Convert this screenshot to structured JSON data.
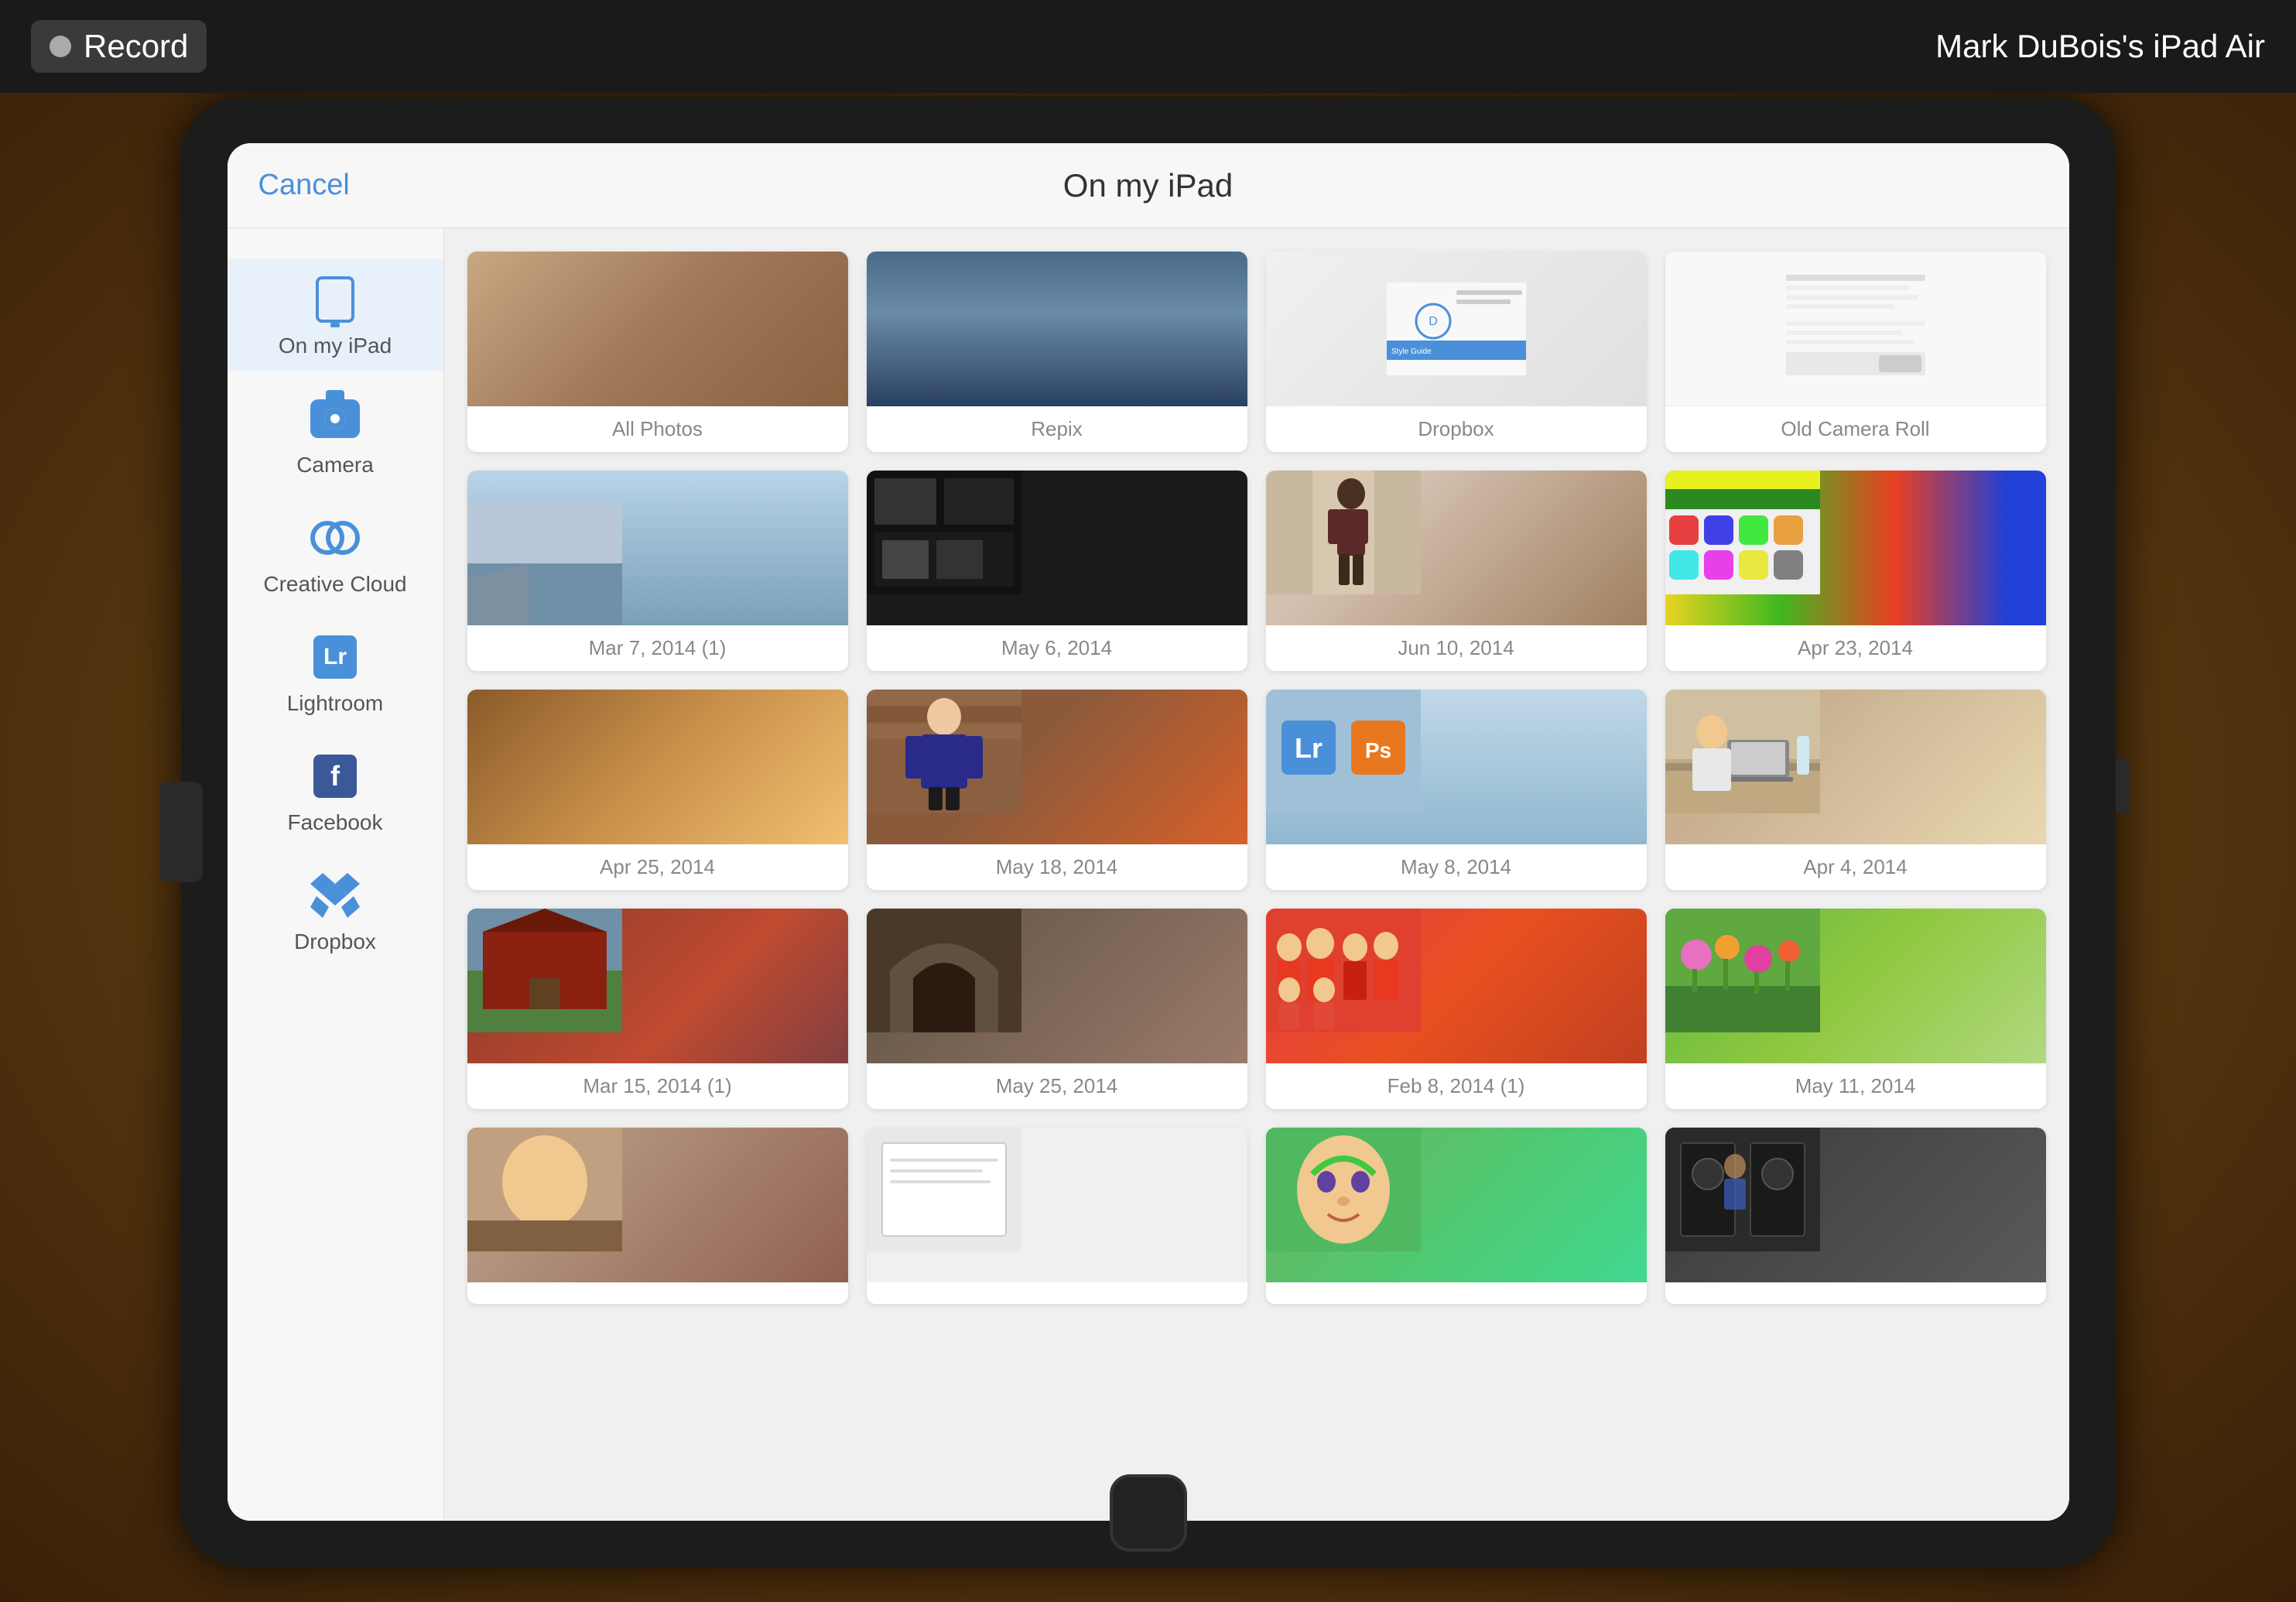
{
  "record_bar": {
    "record_label": "Record",
    "device_name": "Mark DuBois's iPad Air"
  },
  "nav": {
    "cancel": "Cancel",
    "title": "On my iPad"
  },
  "sidebar": {
    "items": [
      {
        "id": "on-my-ipad",
        "label": "On my iPad",
        "active": true
      },
      {
        "id": "camera",
        "label": "Camera",
        "active": false
      },
      {
        "id": "creative-cloud",
        "label": "Creative Cloud",
        "active": false
      },
      {
        "id": "lightroom",
        "label": "Lightroom",
        "active": false
      },
      {
        "id": "facebook",
        "label": "Facebook",
        "active": false
      },
      {
        "id": "dropbox",
        "label": "Dropbox",
        "active": false
      }
    ]
  },
  "grid": {
    "photos": [
      {
        "id": "all-photos",
        "label": "All Photos",
        "thumb_class": "thumb-mantis"
      },
      {
        "id": "repix",
        "label": "Repix",
        "thumb_class": "thumb-repix"
      },
      {
        "id": "dropbox",
        "label": "Dropbox",
        "thumb_class": "thumb-dropbox",
        "has_play": true
      },
      {
        "id": "old-camera-roll",
        "label": "Old Camera Roll",
        "thumb_class": "thumb-oldcam"
      },
      {
        "id": "mar7",
        "label": "Mar 7, 2014 (1)",
        "thumb_class": "thumb-mar7"
      },
      {
        "id": "may6",
        "label": "May 6, 2014",
        "thumb_class": "thumb-may6"
      },
      {
        "id": "jun10",
        "label": "Jun 10, 2014",
        "thumb_class": "thumb-jun10"
      },
      {
        "id": "apr23",
        "label": "Apr 23, 2014",
        "thumb_class": "thumb-apr23"
      },
      {
        "id": "apr25",
        "label": "Apr 25, 2014",
        "thumb_class": "thumb-apr25"
      },
      {
        "id": "may18",
        "label": "May 18, 2014",
        "thumb_class": "thumb-may18"
      },
      {
        "id": "may8",
        "label": "May 8, 2014",
        "thumb_class": "thumb-may8",
        "has_lr_logo": true
      },
      {
        "id": "apr4",
        "label": "Apr 4, 2014",
        "thumb_class": "thumb-apr4"
      },
      {
        "id": "mar15",
        "label": "Mar 15, 2014 (1)",
        "thumb_class": "thumb-mar15"
      },
      {
        "id": "may25",
        "label": "May 25, 2014",
        "thumb_class": "thumb-may25"
      },
      {
        "id": "feb8",
        "label": "Feb 8, 2014 (1)",
        "thumb_class": "thumb-feb8"
      },
      {
        "id": "may11",
        "label": "May 11, 2014",
        "thumb_class": "thumb-may11"
      },
      {
        "id": "row5a",
        "label": "",
        "thumb_class": "thumb-row5a"
      },
      {
        "id": "row5b",
        "label": "",
        "thumb_class": "thumb-row5b"
      },
      {
        "id": "row5c",
        "label": "",
        "thumb_class": "thumb-row5c"
      },
      {
        "id": "row5d",
        "label": "",
        "thumb_class": "thumb-row5d"
      }
    ]
  }
}
